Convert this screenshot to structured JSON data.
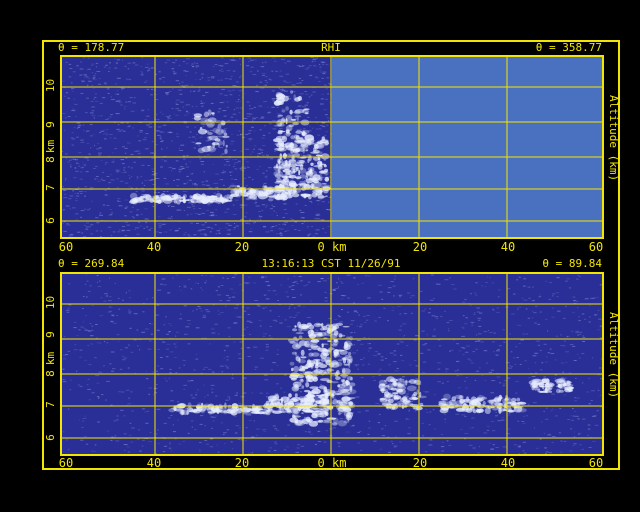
{
  "colors": {
    "frame": "#f2e600",
    "echo_bg": "#2a2f97",
    "blank_bg": "#4a70c0",
    "echo": "#e8eeff"
  },
  "top_panel": {
    "left_angle": "θ = 178.77",
    "title": "RHI",
    "right_angle": "θ = 358.77",
    "y_ticks": [
      "10",
      "9",
      "8",
      "7",
      "6"
    ],
    "y_unit": "km",
    "right_axis_label": "Altitude (km)",
    "x_ticks": [
      "60",
      "40",
      "20",
      "0 km",
      "20",
      "40",
      "60"
    ]
  },
  "bottom_panel": {
    "left_angle": "θ = 269.84",
    "timestamp": "13:16:13 CST 11/26/91",
    "right_angle": "θ = 89.84",
    "y_ticks": [
      "10",
      "9",
      "8",
      "7",
      "6"
    ],
    "y_unit": "km",
    "right_axis_label": "Altitude (km)",
    "x_ticks": [
      "60",
      "40",
      "20",
      "0 km",
      "20",
      "40",
      "60"
    ]
  }
}
